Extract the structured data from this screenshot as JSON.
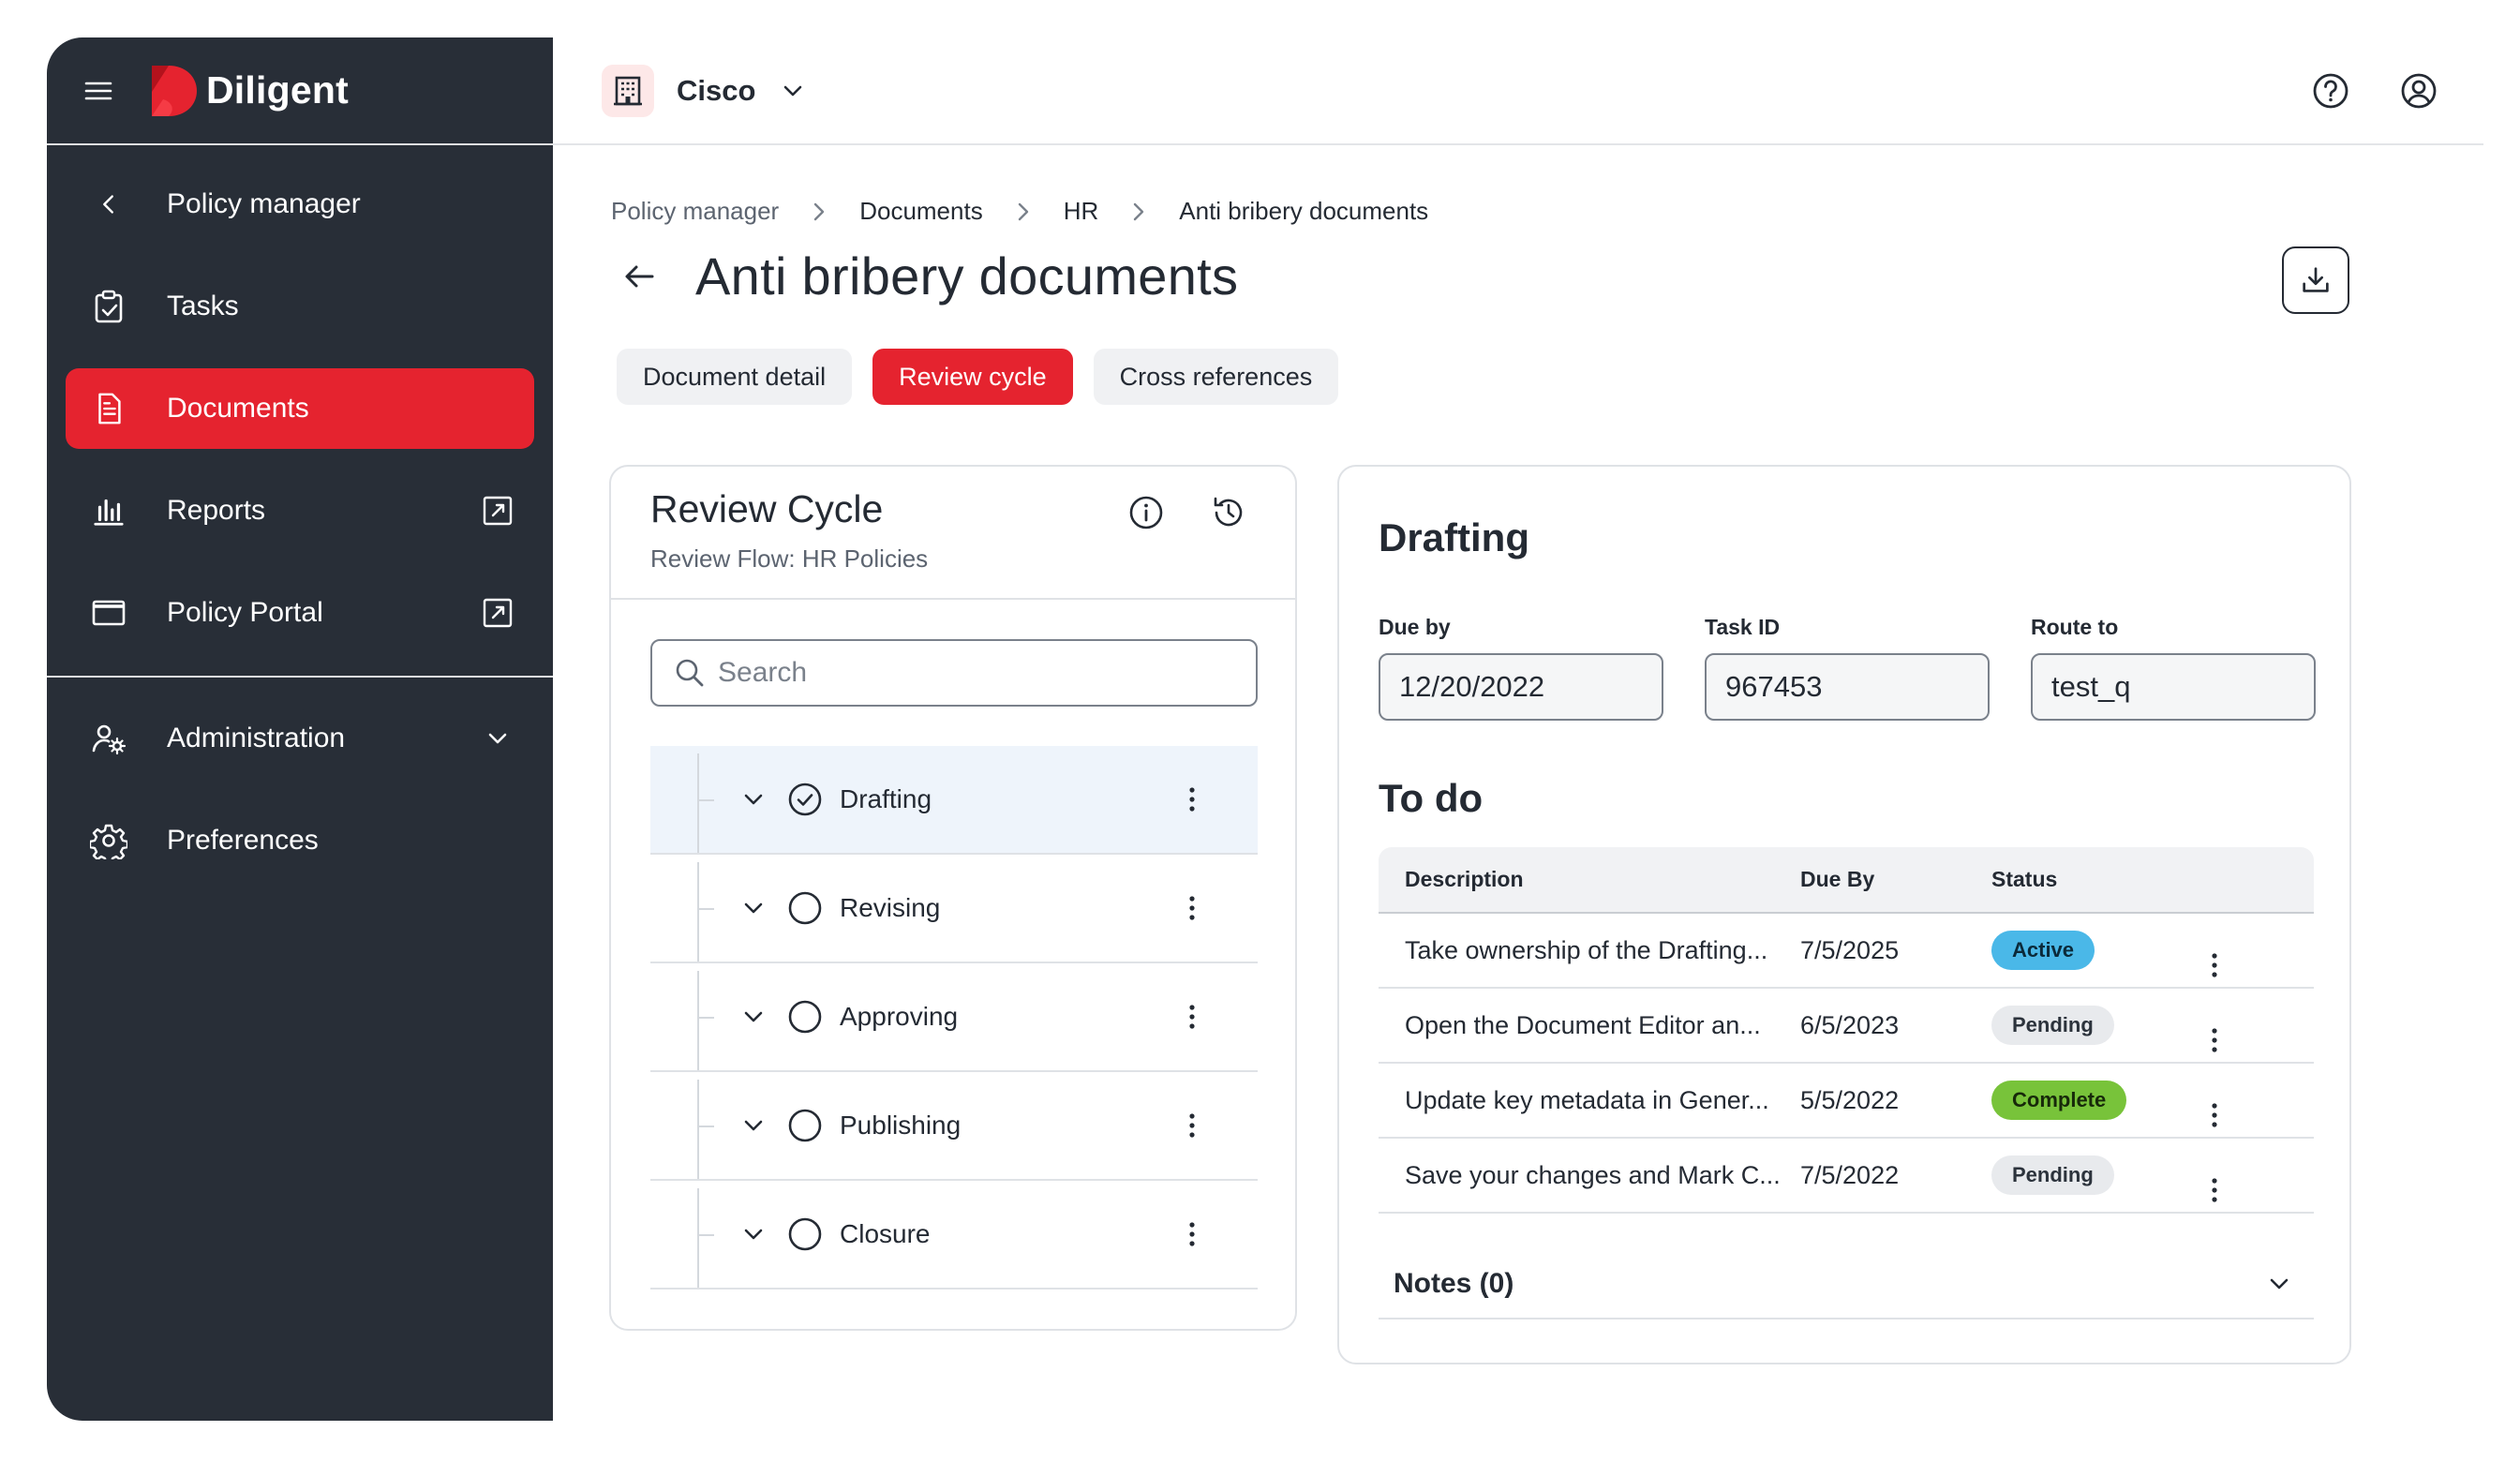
{
  "brand": {
    "name": "Diligent",
    "color": "#e5232f"
  },
  "sidebar": {
    "main_items": [
      {
        "label": "Policy manager",
        "icon": "chevron-left-icon"
      },
      {
        "label": "Tasks",
        "icon": "clipboard-check-icon"
      },
      {
        "label": "Documents",
        "icon": "document-icon",
        "active": true
      },
      {
        "label": "Reports",
        "icon": "bar-chart-icon",
        "external": true
      },
      {
        "label": "Policy Portal",
        "icon": "window-icon",
        "external": true
      }
    ],
    "admin_items": [
      {
        "label": "Administration",
        "icon": "user-gear-icon",
        "expandable": true
      },
      {
        "label": "Preferences",
        "icon": "gear-icon"
      }
    ]
  },
  "topbar": {
    "org_name": "Cisco",
    "org_icon": "building-icon"
  },
  "breadcrumb": [
    "Policy manager",
    "Documents",
    "HR",
    "Anti bribery documents"
  ],
  "page": {
    "title": "Anti bribery documents"
  },
  "tabs": [
    {
      "label": "Document detail",
      "active": false
    },
    {
      "label": "Review cycle",
      "active": true
    },
    {
      "label": "Cross references",
      "active": false
    }
  ],
  "review_cycle": {
    "title": "Review Cycle",
    "subtitle": "Review Flow: HR Policies",
    "search_placeholder": "Search",
    "steps": [
      {
        "label": "Drafting",
        "done": true,
        "selected": true
      },
      {
        "label": "Revising",
        "done": false
      },
      {
        "label": "Approving",
        "done": false
      },
      {
        "label": "Publishing",
        "done": false
      },
      {
        "label": "Closure",
        "done": false
      }
    ]
  },
  "drafting": {
    "title": "Drafting",
    "fields": [
      {
        "label": "Due by",
        "value": "12/20/2022"
      },
      {
        "label": "Task ID",
        "value": "967453"
      },
      {
        "label": "Route to",
        "value": "test_q"
      }
    ],
    "todo_title": "To do",
    "columns": [
      "Description",
      "Due By",
      "Status"
    ],
    "rows": [
      {
        "description": "Take ownership of the Drafting...",
        "due": "7/5/2025",
        "status": "Active",
        "status_kind": "active"
      },
      {
        "description": "Open the Document Editor an...",
        "due": "6/5/2023",
        "status": "Pending",
        "status_kind": "pending"
      },
      {
        "description": "Update key metadata in Gener...",
        "due": "5/5/2022",
        "status": "Complete",
        "status_kind": "complete"
      },
      {
        "description": "Save your changes and Mark C...",
        "due": "7/5/2022",
        "status": "Pending",
        "status_kind": "pending"
      }
    ],
    "notes_label": "Notes (0)"
  },
  "colors": {
    "status_active": "#4ab8e8",
    "status_pending": "#e8eaed",
    "status_complete": "#78c33a",
    "sidebar_bg": "#282e37"
  }
}
